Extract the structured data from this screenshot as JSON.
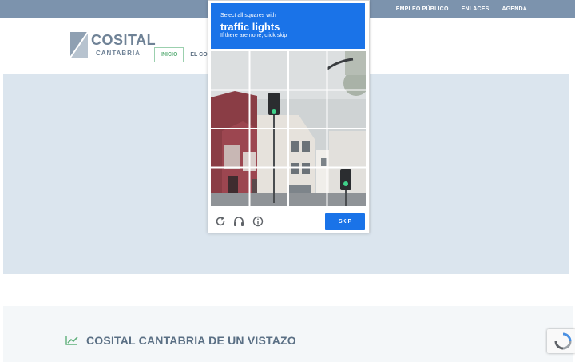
{
  "topbar": {
    "links": [
      "EMPLEO PÚBLICO",
      "ENLACES",
      "AGENDA"
    ]
  },
  "logo": {
    "word": "COSITAL",
    "sub": "CANTABRIA"
  },
  "mainnav": {
    "active": "INICIO",
    "second": "EL COL"
  },
  "section": {
    "title": "COSITAL CANTABRIA DE UN VISTAZO"
  },
  "captcha": {
    "line1": "Select all squares with",
    "line2": "traffic lights",
    "line3": "If there are none, click skip",
    "skip_label": "SKIP",
    "icons": [
      "reload-icon",
      "headphones-icon",
      "info-icon"
    ]
  },
  "colors": {
    "topbar": "#7c93ad",
    "captcha_blue": "#1a73e8",
    "hero": "#dbe5ee",
    "accent_green": "#5fb07b"
  }
}
